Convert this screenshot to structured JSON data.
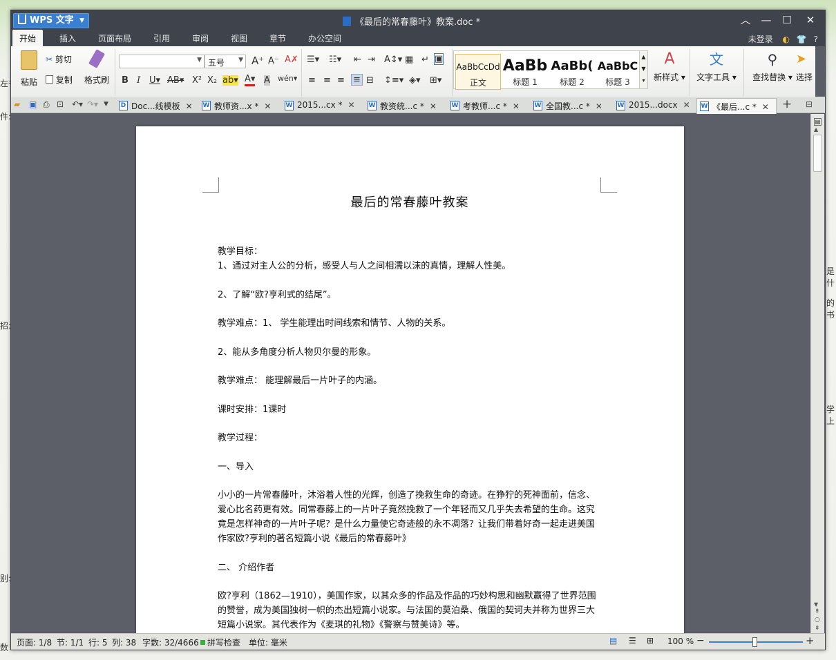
{
  "app": {
    "name": "WPS 文字",
    "doc_title": "《最后的常春藤叶》教案.doc *"
  },
  "window_controls": {
    "collapse": "︿",
    "minimize": "—",
    "maximize": "☐",
    "close": "✕"
  },
  "menu": {
    "items": [
      "开始",
      "插入",
      "页面布局",
      "引用",
      "审阅",
      "视图",
      "章节",
      "办公空间"
    ],
    "active": "开始",
    "login": "未登录",
    "help": "?"
  },
  "ribbon": {
    "clipboard": {
      "paste": "粘贴",
      "cut": "剪切",
      "copy": "复制",
      "format_painter": "格式刷"
    },
    "font": {
      "family_value": "",
      "size_value": "五号"
    },
    "styles": [
      {
        "sample": "AaBbCcDd",
        "name": "正文"
      },
      {
        "sample": "AaBb",
        "name": "标题 1"
      },
      {
        "sample": "AaBb(",
        "name": "标题 2"
      },
      {
        "sample": "AaBbC",
        "name": "标题 3"
      }
    ],
    "new_style": "新样式",
    "text_tools": "文字工具",
    "find_replace": "查找替换",
    "select": "选择"
  },
  "tabs": [
    {
      "label": "Doc...线模板",
      "modified": false
    },
    {
      "label": "教师资...x *",
      "modified": true
    },
    {
      "label": "2015...cx *",
      "modified": true
    },
    {
      "label": "教资统...c *",
      "modified": true
    },
    {
      "label": "考教师...c *",
      "modified": true
    },
    {
      "label": "全国教...c *",
      "modified": true
    },
    {
      "label": "2015...docx",
      "modified": false
    },
    {
      "label": "《最后...c *",
      "modified": true,
      "active": true
    }
  ],
  "document": {
    "title": "最后的常春藤叶教案",
    "paragraphs": [
      "教学目标：",
      "1、通过对主人公的分析，感受人与人之间相濡以沫的真情，理解人性美。",
      "2、了解“欧?亨利式的结尾”。",
      "教学难点：1、 学生能理出时间线索和情节、人物的关系。",
      "2、能从多角度分析人物贝尔曼的形象。",
      "教学难点：  能理解最后一片叶子的内涵。",
      "课时安排：1课时",
      "教学过程：",
      "一、导入",
      "小小的一片常春藤叶，沐浴着人性的光辉，创造了挽救生命的奇迹。在狰狞的死神面前，信念、爱心比名药更有效。同常春藤上的一片叶子竟然挽救了一个年轻而又几乎失去希望的生命。这究竟是怎样神奇的一片叶子呢？是什么力量使它奇迹般的永不凋落？让我们带着好奇一起走进美国作家欧?亨利的著名短篇小说《最后的常春藤叶》",
      "二、 介绍作者",
      "欧?亨利（1862—1910），美国作家，以其众多的作品及作品的巧妙构思和幽默赢得了世界范围的赞誉，成为美国独树一帜的杰出短篇小说家。与法国的莫泊桑、俄国的契诃夫并称为世界三大短篇小说家。其代表作为《麦琪的礼物》《警察与赞美诗》等。"
    ]
  },
  "status": {
    "page": "页面: 1/8",
    "section": "节: 1/1",
    "line": "行: 5",
    "column": "列: 38",
    "word_count": "字数: 32/4666",
    "spell_check": "拼写检查",
    "unit": "单位: 毫米",
    "zoom": "100 %",
    "zoom_percent": 100
  },
  "background_fragments": [
    "左书",
    "件:",
    "招:",
    "别:",
    "数",
    "是什",
    "的书",
    "学上"
  ],
  "colors": {
    "accent": "#3a7fd0",
    "title_bg": "#3f434c",
    "workspace": "#5c5f68"
  }
}
